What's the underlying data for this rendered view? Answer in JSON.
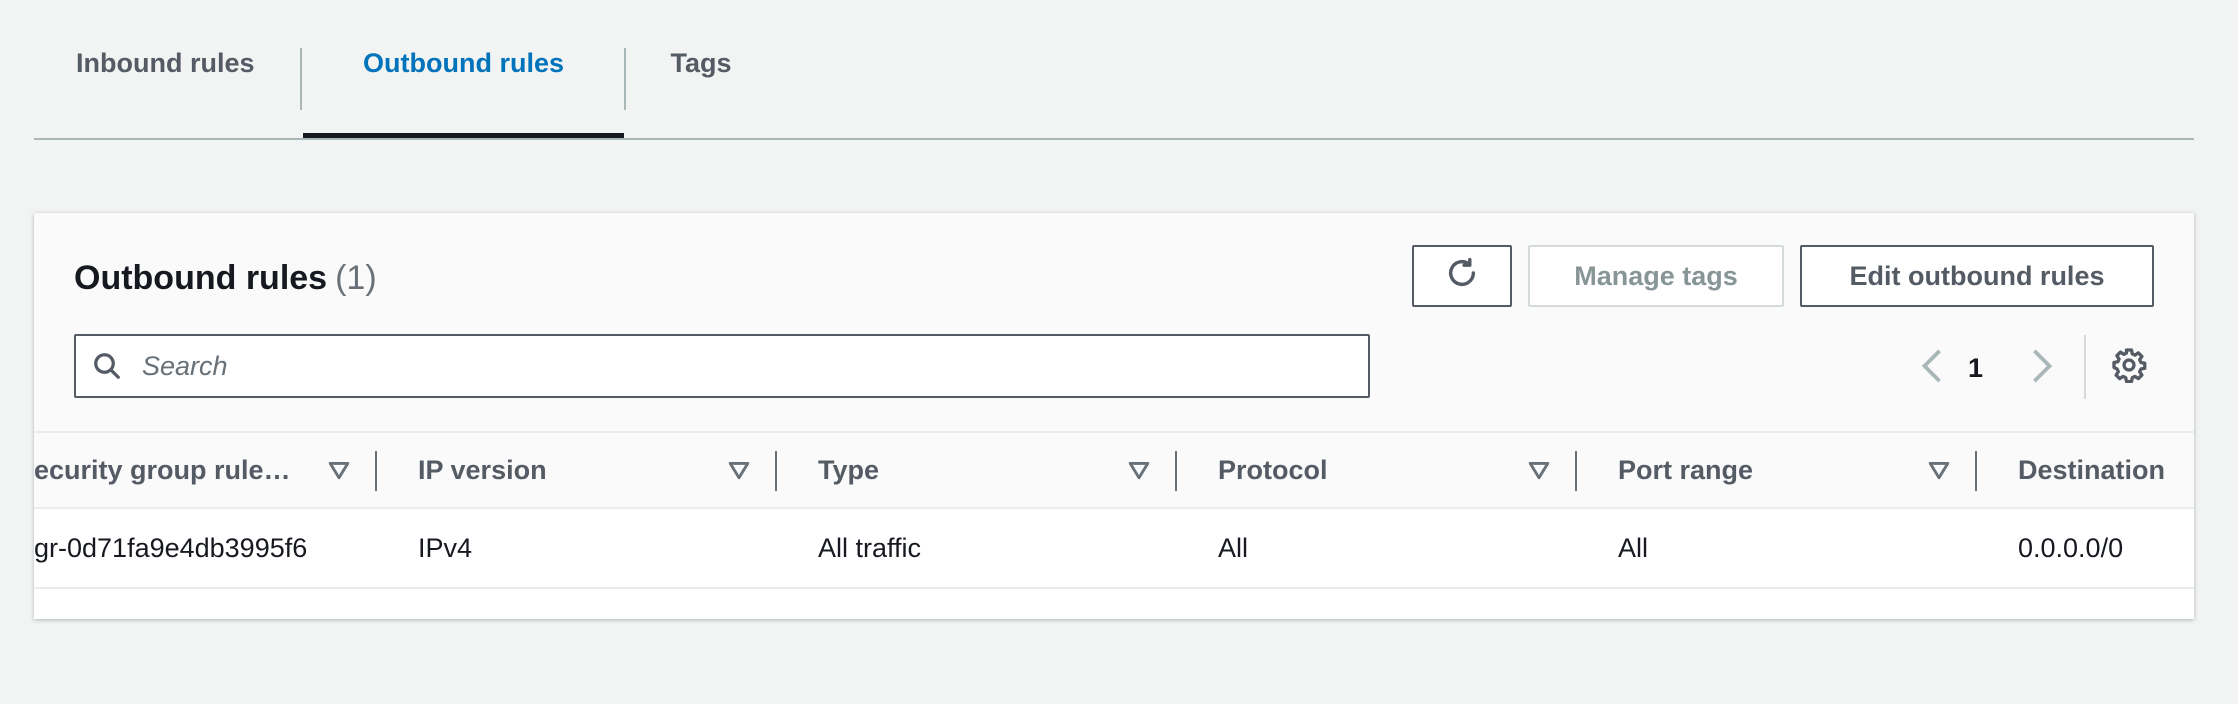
{
  "tabs": [
    {
      "label": "Inbound rules",
      "active": false
    },
    {
      "label": "Outbound rules",
      "active": true
    },
    {
      "label": "Tags",
      "active": false
    }
  ],
  "panel": {
    "title": "Outbound rules",
    "count": "(1)",
    "buttons": {
      "refresh_icon": "refresh-icon",
      "manage_tags": "Manage tags",
      "edit_outbound_rules": "Edit outbound rules"
    },
    "search": {
      "placeholder": "Search",
      "value": ""
    },
    "pagination": {
      "current_page": "1"
    }
  },
  "table": {
    "columns": [
      "ecurity group rule…",
      "IP version",
      "Type",
      "Protocol",
      "Port range",
      "Destination"
    ],
    "rows": [
      {
        "rule_id": "gr-0d71fa9e4db3995f6",
        "ip_version": "IPv4",
        "type": "All traffic",
        "protocol": "All",
        "port_range": "All",
        "destination": "0.0.0.0/0"
      }
    ]
  },
  "colors": {
    "accent": "#0073bb",
    "background": "#f2f3f3",
    "text": "#16191f",
    "muted": "#545b64",
    "disabled": "#879596"
  }
}
